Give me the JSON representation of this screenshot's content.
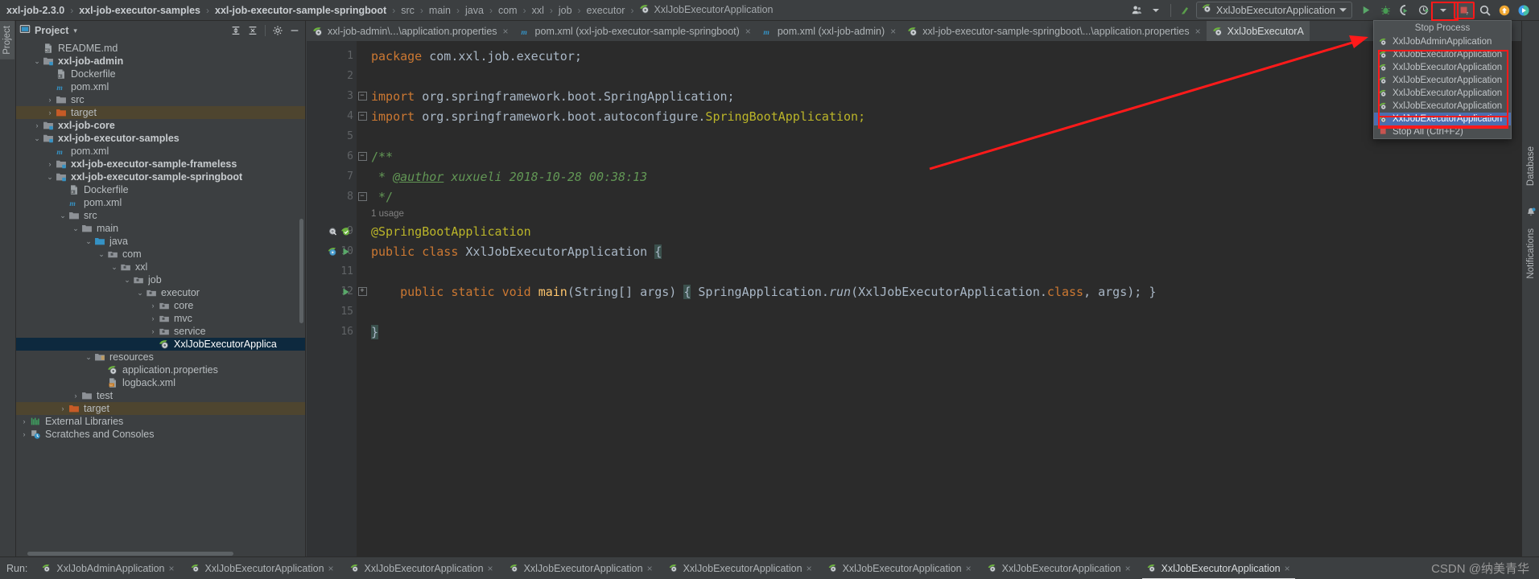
{
  "breadcrumb": {
    "items": [
      {
        "label": "xxl-job-2.3.0",
        "bold": true
      },
      {
        "label": "xxl-job-executor-samples",
        "bold": true
      },
      {
        "label": "xxl-job-executor-sample-springboot",
        "bold": true
      },
      {
        "label": "src",
        "bold": false
      },
      {
        "label": "main",
        "bold": false
      },
      {
        "label": "java",
        "bold": false
      },
      {
        "label": "com",
        "bold": false
      },
      {
        "label": "xxl",
        "bold": false
      },
      {
        "label": "job",
        "bold": false
      },
      {
        "label": "executor",
        "bold": false
      },
      {
        "label": "XxlJobExecutorApplication",
        "bold": false,
        "icon": "spring-class-icon"
      }
    ],
    "separator": "›"
  },
  "toolbar": {
    "account_label": "account-icon",
    "updates_label": "vcs-update-icon",
    "run_config_name": "XxlJobExecutorApplication",
    "run_config_caret": "▾",
    "run_button": "Run",
    "debug_button": "Debug",
    "run_coverage_button": "Run with Coverage",
    "profiler_button": "Profiler",
    "profiler_caret": "▾",
    "stop_button": "Stop",
    "search_button": "Search Everywhere",
    "updates_available_button": "Updates Available",
    "ide_features_button": "IDE Features Trainer"
  },
  "left_strip": {
    "tabs": [
      {
        "label": "Project",
        "active": true
      }
    ]
  },
  "right_strip": {
    "tabs": [
      {
        "label": "Database"
      },
      {
        "label": "Notifications"
      }
    ]
  },
  "project_panel": {
    "title": "Project",
    "caret": "▾",
    "actions": [
      "expand-all-icon",
      "collapse-all-icon",
      "settings-gear-icon",
      "hide-icon"
    ],
    "tree": [
      {
        "label": "README.md",
        "depth": 1,
        "arrow": "",
        "icon": "markdown-file-icon",
        "bold": false
      },
      {
        "label": "xxl-job-admin",
        "depth": 1,
        "arrow": "⌄",
        "icon": "module-folder-icon",
        "bold": true
      },
      {
        "label": "Dockerfile",
        "depth": 2,
        "arrow": "",
        "icon": "docker-file-icon",
        "bold": false
      },
      {
        "label": "pom.xml",
        "depth": 2,
        "arrow": "",
        "icon": "maven-file-icon",
        "bold": false
      },
      {
        "label": "src",
        "depth": 2,
        "arrow": "›",
        "icon": "folder-icon",
        "bold": false
      },
      {
        "label": "target",
        "depth": 2,
        "arrow": "›",
        "icon": "excluded-folder-icon",
        "bold": false,
        "highlight": "target"
      },
      {
        "label": "xxl-job-core",
        "depth": 1,
        "arrow": "›",
        "icon": "module-folder-icon",
        "bold": true
      },
      {
        "label": "xxl-job-executor-samples",
        "depth": 1,
        "arrow": "⌄",
        "icon": "module-folder-icon",
        "bold": true
      },
      {
        "label": "pom.xml",
        "depth": 2,
        "arrow": "",
        "icon": "maven-file-icon",
        "bold": false
      },
      {
        "label": "xxl-job-executor-sample-frameless",
        "depth": 2,
        "arrow": "›",
        "icon": "module-folder-icon",
        "bold": true
      },
      {
        "label": "xxl-job-executor-sample-springboot",
        "depth": 2,
        "arrow": "⌄",
        "icon": "module-folder-icon",
        "bold": true
      },
      {
        "label": "Dockerfile",
        "depth": 3,
        "arrow": "",
        "icon": "docker-file-icon",
        "bold": false
      },
      {
        "label": "pom.xml",
        "depth": 3,
        "arrow": "",
        "icon": "maven-file-icon",
        "bold": false
      },
      {
        "label": "src",
        "depth": 3,
        "arrow": "⌄",
        "icon": "folder-icon",
        "bold": false
      },
      {
        "label": "main",
        "depth": 4,
        "arrow": "⌄",
        "icon": "folder-icon",
        "bold": false
      },
      {
        "label": "java",
        "depth": 5,
        "arrow": "⌄",
        "icon": "source-folder-icon",
        "bold": false
      },
      {
        "label": "com",
        "depth": 6,
        "arrow": "⌄",
        "icon": "package-icon",
        "bold": false
      },
      {
        "label": "xxl",
        "depth": 7,
        "arrow": "⌄",
        "icon": "package-icon",
        "bold": false
      },
      {
        "label": "job",
        "depth": 8,
        "arrow": "⌄",
        "icon": "package-icon",
        "bold": false
      },
      {
        "label": "executor",
        "depth": 9,
        "arrow": "⌄",
        "icon": "package-icon",
        "bold": false
      },
      {
        "label": "core",
        "depth": 10,
        "arrow": "›",
        "icon": "package-icon",
        "bold": false
      },
      {
        "label": "mvc",
        "depth": 10,
        "arrow": "›",
        "icon": "package-icon",
        "bold": false
      },
      {
        "label": "service",
        "depth": 10,
        "arrow": "›",
        "icon": "package-icon",
        "bold": false
      },
      {
        "label": "XxlJobExecutorApplica",
        "depth": 10,
        "arrow": "",
        "icon": "spring-class-icon",
        "bold": false,
        "selected": true
      },
      {
        "label": "resources",
        "depth": 5,
        "arrow": "⌄",
        "icon": "resources-folder-icon",
        "bold": false
      },
      {
        "label": "application.properties",
        "depth": 6,
        "arrow": "",
        "icon": "spring-properties-icon",
        "bold": false
      },
      {
        "label": "logback.xml",
        "depth": 6,
        "arrow": "",
        "icon": "xml-file-icon",
        "bold": false
      },
      {
        "label": "test",
        "depth": 4,
        "arrow": "›",
        "icon": "folder-icon",
        "bold": false
      },
      {
        "label": "target",
        "depth": 3,
        "arrow": "›",
        "icon": "excluded-folder-icon",
        "bold": false,
        "highlight": "target"
      },
      {
        "label": "External Libraries",
        "depth": 0,
        "arrow": "›",
        "icon": "libraries-icon",
        "bold": false
      },
      {
        "label": "Scratches and Consoles",
        "depth": 0,
        "arrow": "›",
        "icon": "scratches-icon",
        "bold": false
      }
    ]
  },
  "editor_tabs": [
    {
      "label": "xxl-job-admin\\...\\application.properties",
      "icon": "spring-properties-icon",
      "active": false,
      "close": "×"
    },
    {
      "label": "pom.xml (xxl-job-executor-sample-springboot)",
      "icon": "maven-file-icon",
      "active": false,
      "close": "×"
    },
    {
      "label": "pom.xml (xxl-job-admin)",
      "icon": "maven-file-icon",
      "active": false,
      "close": "×"
    },
    {
      "label": "xxl-job-executor-sample-springboot\\...\\application.properties",
      "icon": "spring-properties-icon",
      "active": false,
      "close": "×"
    },
    {
      "label": "XxlJobExecutorA",
      "icon": "spring-class-icon",
      "active": true,
      "close": ""
    }
  ],
  "code": {
    "gutter_numbers": [
      "1",
      "2",
      "3",
      "4",
      "5",
      "6",
      "7",
      "8",
      "",
      "9",
      "10",
      "11",
      "12",
      "15",
      "16"
    ],
    "lines": [
      {
        "n": "1",
        "segments": [
          {
            "t": "package ",
            "c": "kw"
          },
          {
            "t": "com.xxl.job.executor;",
            "c": "typ"
          }
        ]
      },
      {
        "n": "2",
        "segments": []
      },
      {
        "n": "3",
        "fold": "−",
        "segments": [
          {
            "t": "import ",
            "c": "kw"
          },
          {
            "t": "org.springframework.boot.SpringApplication;",
            "c": "typ"
          }
        ]
      },
      {
        "n": "4",
        "fold": "⌃",
        "segments": [
          {
            "t": "import ",
            "c": "kw"
          },
          {
            "t": "org.springframework.boot.autoconfigure.",
            "c": "typ"
          },
          {
            "t": "SpringBootApplication;",
            "c": "ann"
          }
        ]
      },
      {
        "n": "5",
        "segments": []
      },
      {
        "n": "6",
        "fold": "−",
        "segments": [
          {
            "t": "/**",
            "c": "cmt-b"
          }
        ]
      },
      {
        "n": "7",
        "segments": [
          {
            "t": " * ",
            "c": "cmt"
          },
          {
            "t": "@author",
            "c": "tag"
          },
          {
            "t": " xuxueli 2018-10-28 00:38:13",
            "c": "cmt"
          }
        ]
      },
      {
        "n": "8",
        "fold": "⌃",
        "segments": [
          {
            "t": " */",
            "c": "cmt-b"
          }
        ]
      },
      {
        "n": "",
        "tiny": true,
        "segments": [
          {
            "t": "1 usage",
            "c": "tiny"
          }
        ]
      },
      {
        "n": "9",
        "marks": [
          "inspection-icon",
          "bookmark-check-icon"
        ],
        "segments": [
          {
            "t": "@SpringBootApplication",
            "c": "ann"
          }
        ]
      },
      {
        "n": "10",
        "marks": [
          "spring-bean-icon",
          "run-gutter-icon"
        ],
        "segments": [
          {
            "t": "public ",
            "c": "kw"
          },
          {
            "t": "class ",
            "c": "kw"
          },
          {
            "t": "XxlJobExecutorApplication ",
            "c": "typ"
          },
          {
            "t": "{",
            "c": "brace"
          }
        ]
      },
      {
        "n": "11",
        "segments": []
      },
      {
        "n": "12",
        "marks": [
          "run-gutter-icon"
        ],
        "fold": "+",
        "segments": [
          {
            "t": "    public ",
            "c": "kw"
          },
          {
            "t": "static ",
            "c": "kw"
          },
          {
            "t": "void ",
            "c": "kw"
          },
          {
            "t": "main",
            "c": "yel"
          },
          {
            "t": "(String[] args) ",
            "c": "typ"
          },
          {
            "t": "{",
            "c": "brace"
          },
          {
            "t": " SpringApplication.",
            "c": "typ"
          },
          {
            "t": "run",
            "c": "italic"
          },
          {
            "t": "(XxlJobExecutorApplication.",
            "c": "typ"
          },
          {
            "t": "class",
            "c": "kw"
          },
          {
            "t": ", args); }",
            "c": "typ"
          }
        ]
      },
      {
        "n": "15",
        "segments": []
      },
      {
        "n": "16",
        "segments": [
          {
            "t": "}",
            "c": "brace"
          }
        ]
      }
    ]
  },
  "stop_popup": {
    "title": "Stop Process",
    "items": [
      {
        "label": "XxlJobAdminApplication",
        "icon": "spring-process-icon",
        "selected": false,
        "boxed": false
      },
      {
        "label": "XxlJobExecutorApplication",
        "icon": "spring-process-icon",
        "selected": false,
        "boxed": true
      },
      {
        "label": "XxlJobExecutorApplication",
        "icon": "spring-process-icon",
        "selected": false,
        "boxed": true
      },
      {
        "label": "XxlJobExecutorApplication",
        "icon": "spring-process-icon",
        "selected": false,
        "boxed": true
      },
      {
        "label": "XxlJobExecutorApplication",
        "icon": "spring-process-icon",
        "selected": false,
        "boxed": true
      },
      {
        "label": "XxlJobExecutorApplication",
        "icon": "spring-process-icon",
        "selected": false,
        "boxed": true
      },
      {
        "label": "XxlJobExecutorApplication",
        "icon": "spring-process-icon",
        "selected": true,
        "boxed": true
      },
      {
        "label": "Stop All (Ctrl+F2)",
        "icon": "stop-all-icon",
        "selected": false,
        "boxed": false
      }
    ]
  },
  "run_bar": {
    "label": "Run:",
    "tabs": [
      {
        "label": "XxlJobAdminApplication",
        "active": false,
        "close": "×"
      },
      {
        "label": "XxlJobExecutorApplication",
        "active": false,
        "close": "×"
      },
      {
        "label": "XxlJobExecutorApplication",
        "active": false,
        "close": "×"
      },
      {
        "label": "XxlJobExecutorApplication",
        "active": false,
        "close": "×"
      },
      {
        "label": "XxlJobExecutorApplication",
        "active": false,
        "close": "×"
      },
      {
        "label": "XxlJobExecutorApplication",
        "active": false,
        "close": "×"
      },
      {
        "label": "XxlJobExecutorApplication",
        "active": false,
        "close": "×"
      },
      {
        "label": "XxlJobExecutorApplication",
        "active": true,
        "close": "×"
      }
    ],
    "watermark": "CSDN @纳美青华"
  },
  "colors": {
    "accent_red": "#ff1a1a",
    "selection_blue": "#4b6eaf",
    "tree_selection": "#0d293e",
    "editor_bg": "#2b2b2b",
    "panel_bg": "#3c3f41"
  }
}
